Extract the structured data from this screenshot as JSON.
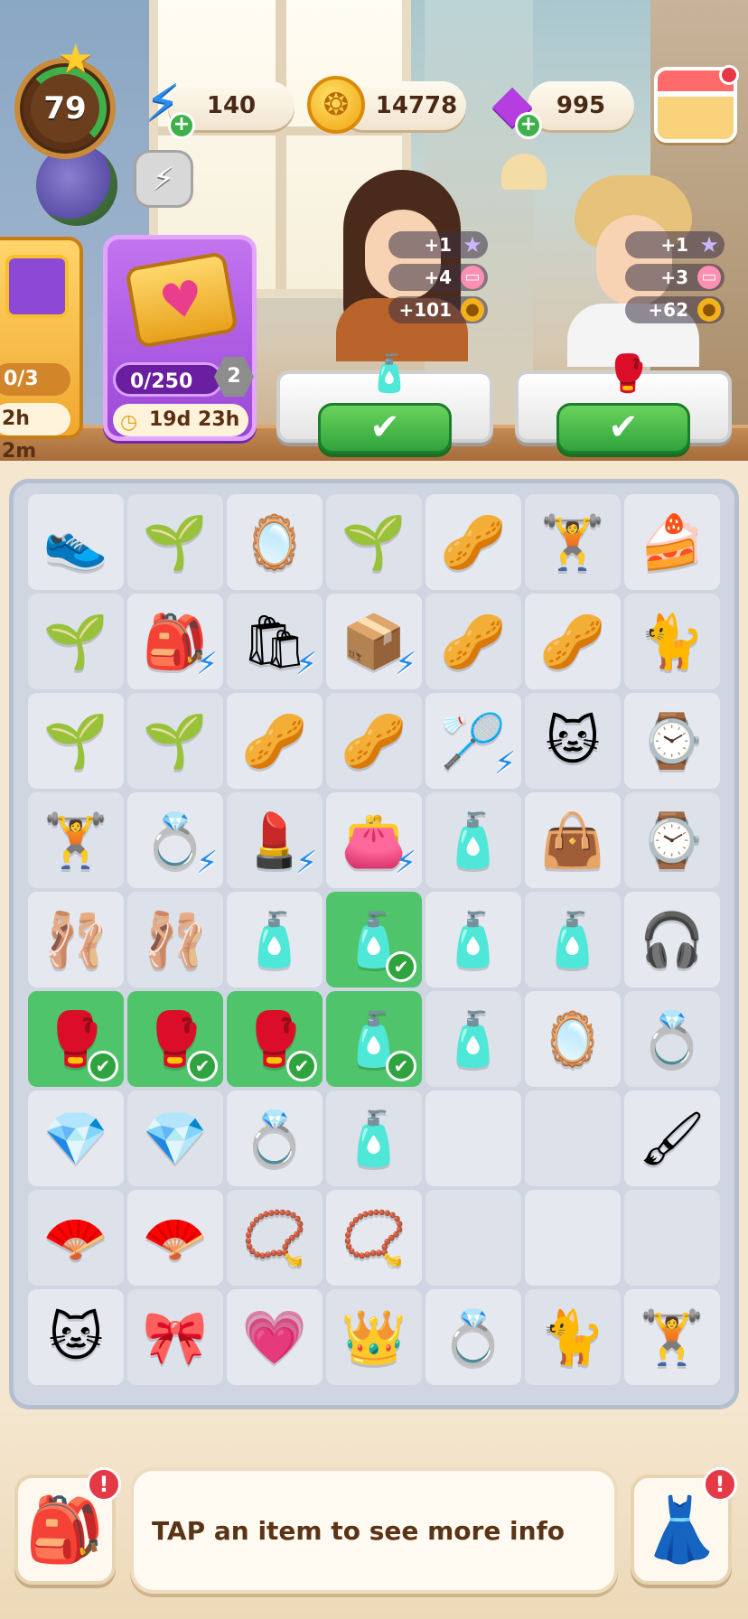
{
  "hud": {
    "level": "79",
    "energy": "140",
    "coins": "14778",
    "gems": "995"
  },
  "events": {
    "gift": {
      "progress": "0/3",
      "time": "2h 2m"
    },
    "heart_pass": {
      "progress": "0/250",
      "tier": "2",
      "time": "19d 23h"
    }
  },
  "orders": [
    {
      "rewards": [
        "+1",
        "+4",
        "+101"
      ],
      "item_icon": "serum-bottle-icon"
    },
    {
      "rewards": [
        "+1",
        "+3",
        "+62"
      ],
      "item_icon": "boxing-glove-icon"
    }
  ],
  "board": {
    "rows": [
      [
        "👟",
        "🌱",
        "🪞",
        "🌱",
        "🥜",
        "🏋",
        "🍰"
      ],
      [
        "🌱",
        "🎒",
        "🛍",
        "📦",
        "🥜",
        "🥜",
        "🐈"
      ],
      [
        "🌱",
        "🌱",
        "🥜",
        "🥜",
        "🏸",
        "🐱",
        "⌚"
      ],
      [
        "🏋",
        "💍",
        "💄",
        "👛",
        "🧴",
        "👜",
        "⌚"
      ],
      [
        "🩰",
        "🩰",
        "🧴",
        "🧴",
        "🧴",
        "🧴",
        "🎧"
      ],
      [
        "🥊",
        "🥊",
        "🥊",
        "🧴",
        "🧴",
        "🪞",
        "💍"
      ],
      [
        "💎",
        "💎",
        "💍",
        "🧴",
        "",
        "",
        "🖌"
      ],
      [
        "🪭",
        "🪭",
        "📿",
        "📿",
        "",
        "",
        ""
      ],
      [
        "🐱",
        "🎀",
        "💗",
        "👑",
        "💍",
        "🐈",
        "🏋"
      ]
    ]
  },
  "bottom": {
    "info_text": "TAP an item to see more info"
  }
}
